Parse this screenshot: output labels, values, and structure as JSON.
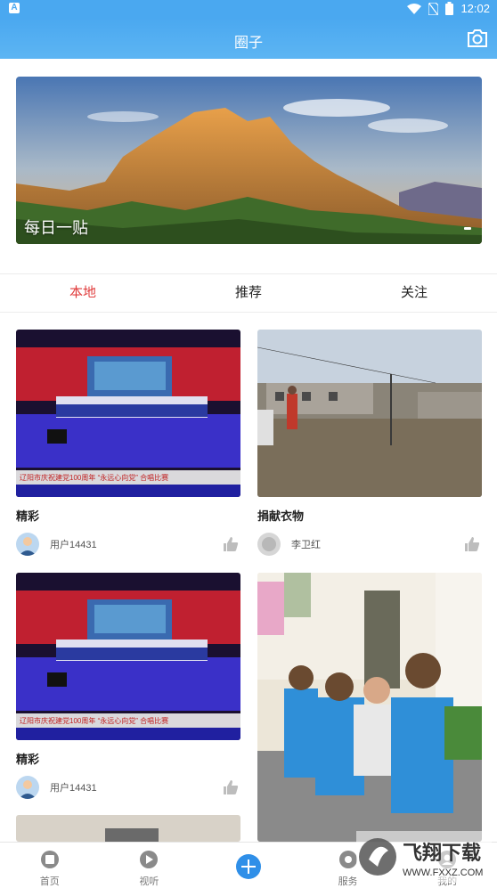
{
  "status_bar": {
    "time": "12:02",
    "left_badge": "A"
  },
  "header": {
    "title": "圈子",
    "camera_icon": "camera-icon"
  },
  "banner": {
    "caption": "每日一贴"
  },
  "tabs": [
    {
      "label": "本地",
      "active": true
    },
    {
      "label": "推荐",
      "active": false
    },
    {
      "label": "关注",
      "active": false
    }
  ],
  "posts": [
    {
      "title": "精彩",
      "author": "用户14431",
      "image_text": "辽阳市庆祝建党100周年 “永远心向党” 合唱比赛"
    },
    {
      "title": "捐献衣物",
      "author": "李卫红"
    },
    {
      "title": "精彩",
      "author": "用户14431",
      "image_text": "辽阳市庆祝建党100周年 “永远心向党” 合唱比赛"
    },
    {
      "title": "",
      "author": ""
    }
  ],
  "bottom_nav": [
    {
      "label": "首页",
      "icon": "home-icon"
    },
    {
      "label": "视听",
      "icon": "play-icon"
    },
    {
      "label": "",
      "icon": "plus-icon"
    },
    {
      "label": "服务",
      "icon": "service-icon"
    },
    {
      "label": "我的",
      "icon": "profile-icon"
    }
  ],
  "watermark": {
    "brand": "飞翔下载",
    "url": "WWW.FXXZ.COM"
  },
  "colors": {
    "primary": "#4aa8f0",
    "active_tab": "#e03c3c",
    "plus_button": "#2f8fe8"
  }
}
